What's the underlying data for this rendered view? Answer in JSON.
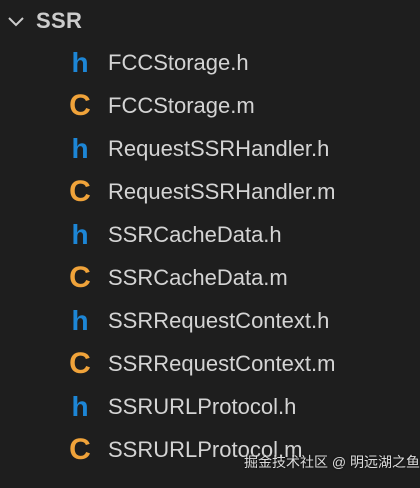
{
  "folder": {
    "name": "SSR",
    "expanded": true
  },
  "files": [
    {
      "name": "FCCStorage.h",
      "icon": "h-file-icon",
      "icon_glyph": "h"
    },
    {
      "name": "FCCStorage.m",
      "icon": "c-file-icon",
      "icon_glyph": "C"
    },
    {
      "name": "RequestSSRHandler.h",
      "icon": "h-file-icon",
      "icon_glyph": "h"
    },
    {
      "name": "RequestSSRHandler.m",
      "icon": "c-file-icon",
      "icon_glyph": "C"
    },
    {
      "name": "SSRCacheData.h",
      "icon": "h-file-icon",
      "icon_glyph": "h"
    },
    {
      "name": "SSRCacheData.m",
      "icon": "c-file-icon",
      "icon_glyph": "C"
    },
    {
      "name": "SSRRequestContext.h",
      "icon": "h-file-icon",
      "icon_glyph": "h"
    },
    {
      "name": "SSRRequestContext.m",
      "icon": "c-file-icon",
      "icon_glyph": "C"
    },
    {
      "name": "SSRURLProtocol.h",
      "icon": "h-file-icon",
      "icon_glyph": "h"
    },
    {
      "name": "SSRURLProtocol.m",
      "icon": "c-file-icon",
      "icon_glyph": "C"
    }
  ],
  "watermark": "掘金技术社区 @ 明远湖之鱼",
  "colors": {
    "background": "#1e1e1e",
    "header_icon": "#1d86d6",
    "source_icon": "#f0a33a",
    "text": "#d4d4d4"
  }
}
